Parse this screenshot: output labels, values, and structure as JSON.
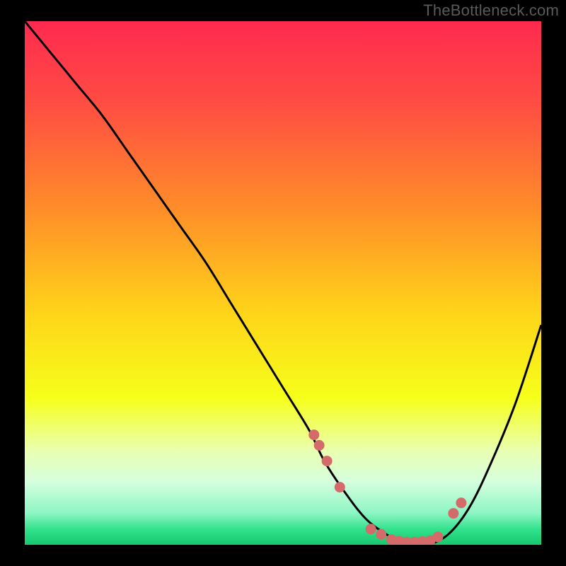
{
  "watermark": "TheBottleneck.com",
  "chart_data": {
    "type": "line",
    "title": "",
    "xlabel": "",
    "ylabel": "",
    "xlim": [
      0,
      100
    ],
    "ylim": [
      0,
      100
    ],
    "series": [
      {
        "name": "bottleneck-curve",
        "x": [
          0,
          5,
          10,
          15,
          20,
          25,
          30,
          35,
          40,
          45,
          50,
          55,
          58,
          62,
          66,
          70,
          74,
          78,
          82,
          86,
          90,
          95,
          100
        ],
        "values": [
          100,
          94,
          88,
          82,
          75,
          68,
          61,
          54,
          46,
          38,
          30,
          22,
          16,
          10,
          5,
          2,
          0,
          0,
          2,
          7,
          15,
          27,
          42
        ]
      }
    ],
    "markers": {
      "name": "highlight-dots",
      "color": "#d56a6a",
      "x": [
        56,
        57,
        58.5,
        61,
        67,
        69,
        71,
        72.5,
        74,
        75.5,
        77,
        78.5,
        80,
        83,
        84.5
      ],
      "values": [
        21,
        19,
        16,
        11,
        3,
        2,
        1,
        0.7,
        0.5,
        0.5,
        0.6,
        0.8,
        1.5,
        6,
        8
      ]
    },
    "gradient_stops": [
      {
        "offset": 0.0,
        "color": "#ff2a4f"
      },
      {
        "offset": 0.15,
        "color": "#ff4b44"
      },
      {
        "offset": 0.35,
        "color": "#ff8a2a"
      },
      {
        "offset": 0.55,
        "color": "#ffd21a"
      },
      {
        "offset": 0.72,
        "color": "#f6ff1a"
      },
      {
        "offset": 0.82,
        "color": "#eaffb0"
      },
      {
        "offset": 0.88,
        "color": "#d6ffdf"
      },
      {
        "offset": 0.94,
        "color": "#8cf5c3"
      },
      {
        "offset": 0.97,
        "color": "#33e28d"
      },
      {
        "offset": 1.0,
        "color": "#17c86f"
      }
    ]
  }
}
